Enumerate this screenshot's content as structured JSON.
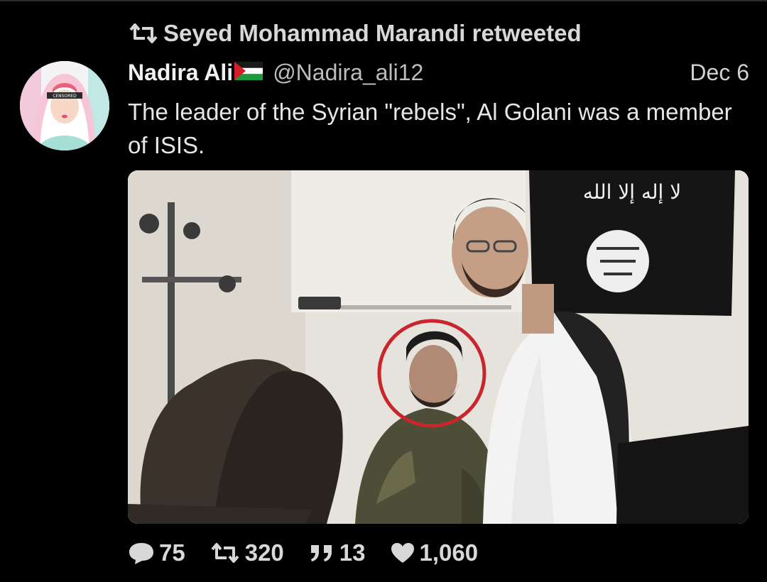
{
  "retweet": {
    "icon": "retweet-icon",
    "text": "Seyed Mohammad Marandi retweeted"
  },
  "author": {
    "display_name": "Nadira Ali",
    "flag": "palestine-flag-icon",
    "handle": "@Nadira_ali12",
    "avatar_badge": "CENSORED"
  },
  "tweet": {
    "date": "Dec 6",
    "text": "The leader of the Syrian \"rebels\", Al Golani was a member of ISIS."
  },
  "media": {
    "banner_text": "لا إله إلا الله"
  },
  "actions": {
    "replies": "75",
    "retweets": "320",
    "quotes": "13",
    "likes": "1,060"
  },
  "colors": {
    "background": "#000000",
    "text": "#e6e6e6",
    "secondary_text": "#bdbdbd",
    "highlight_circle": "#c8262c"
  }
}
